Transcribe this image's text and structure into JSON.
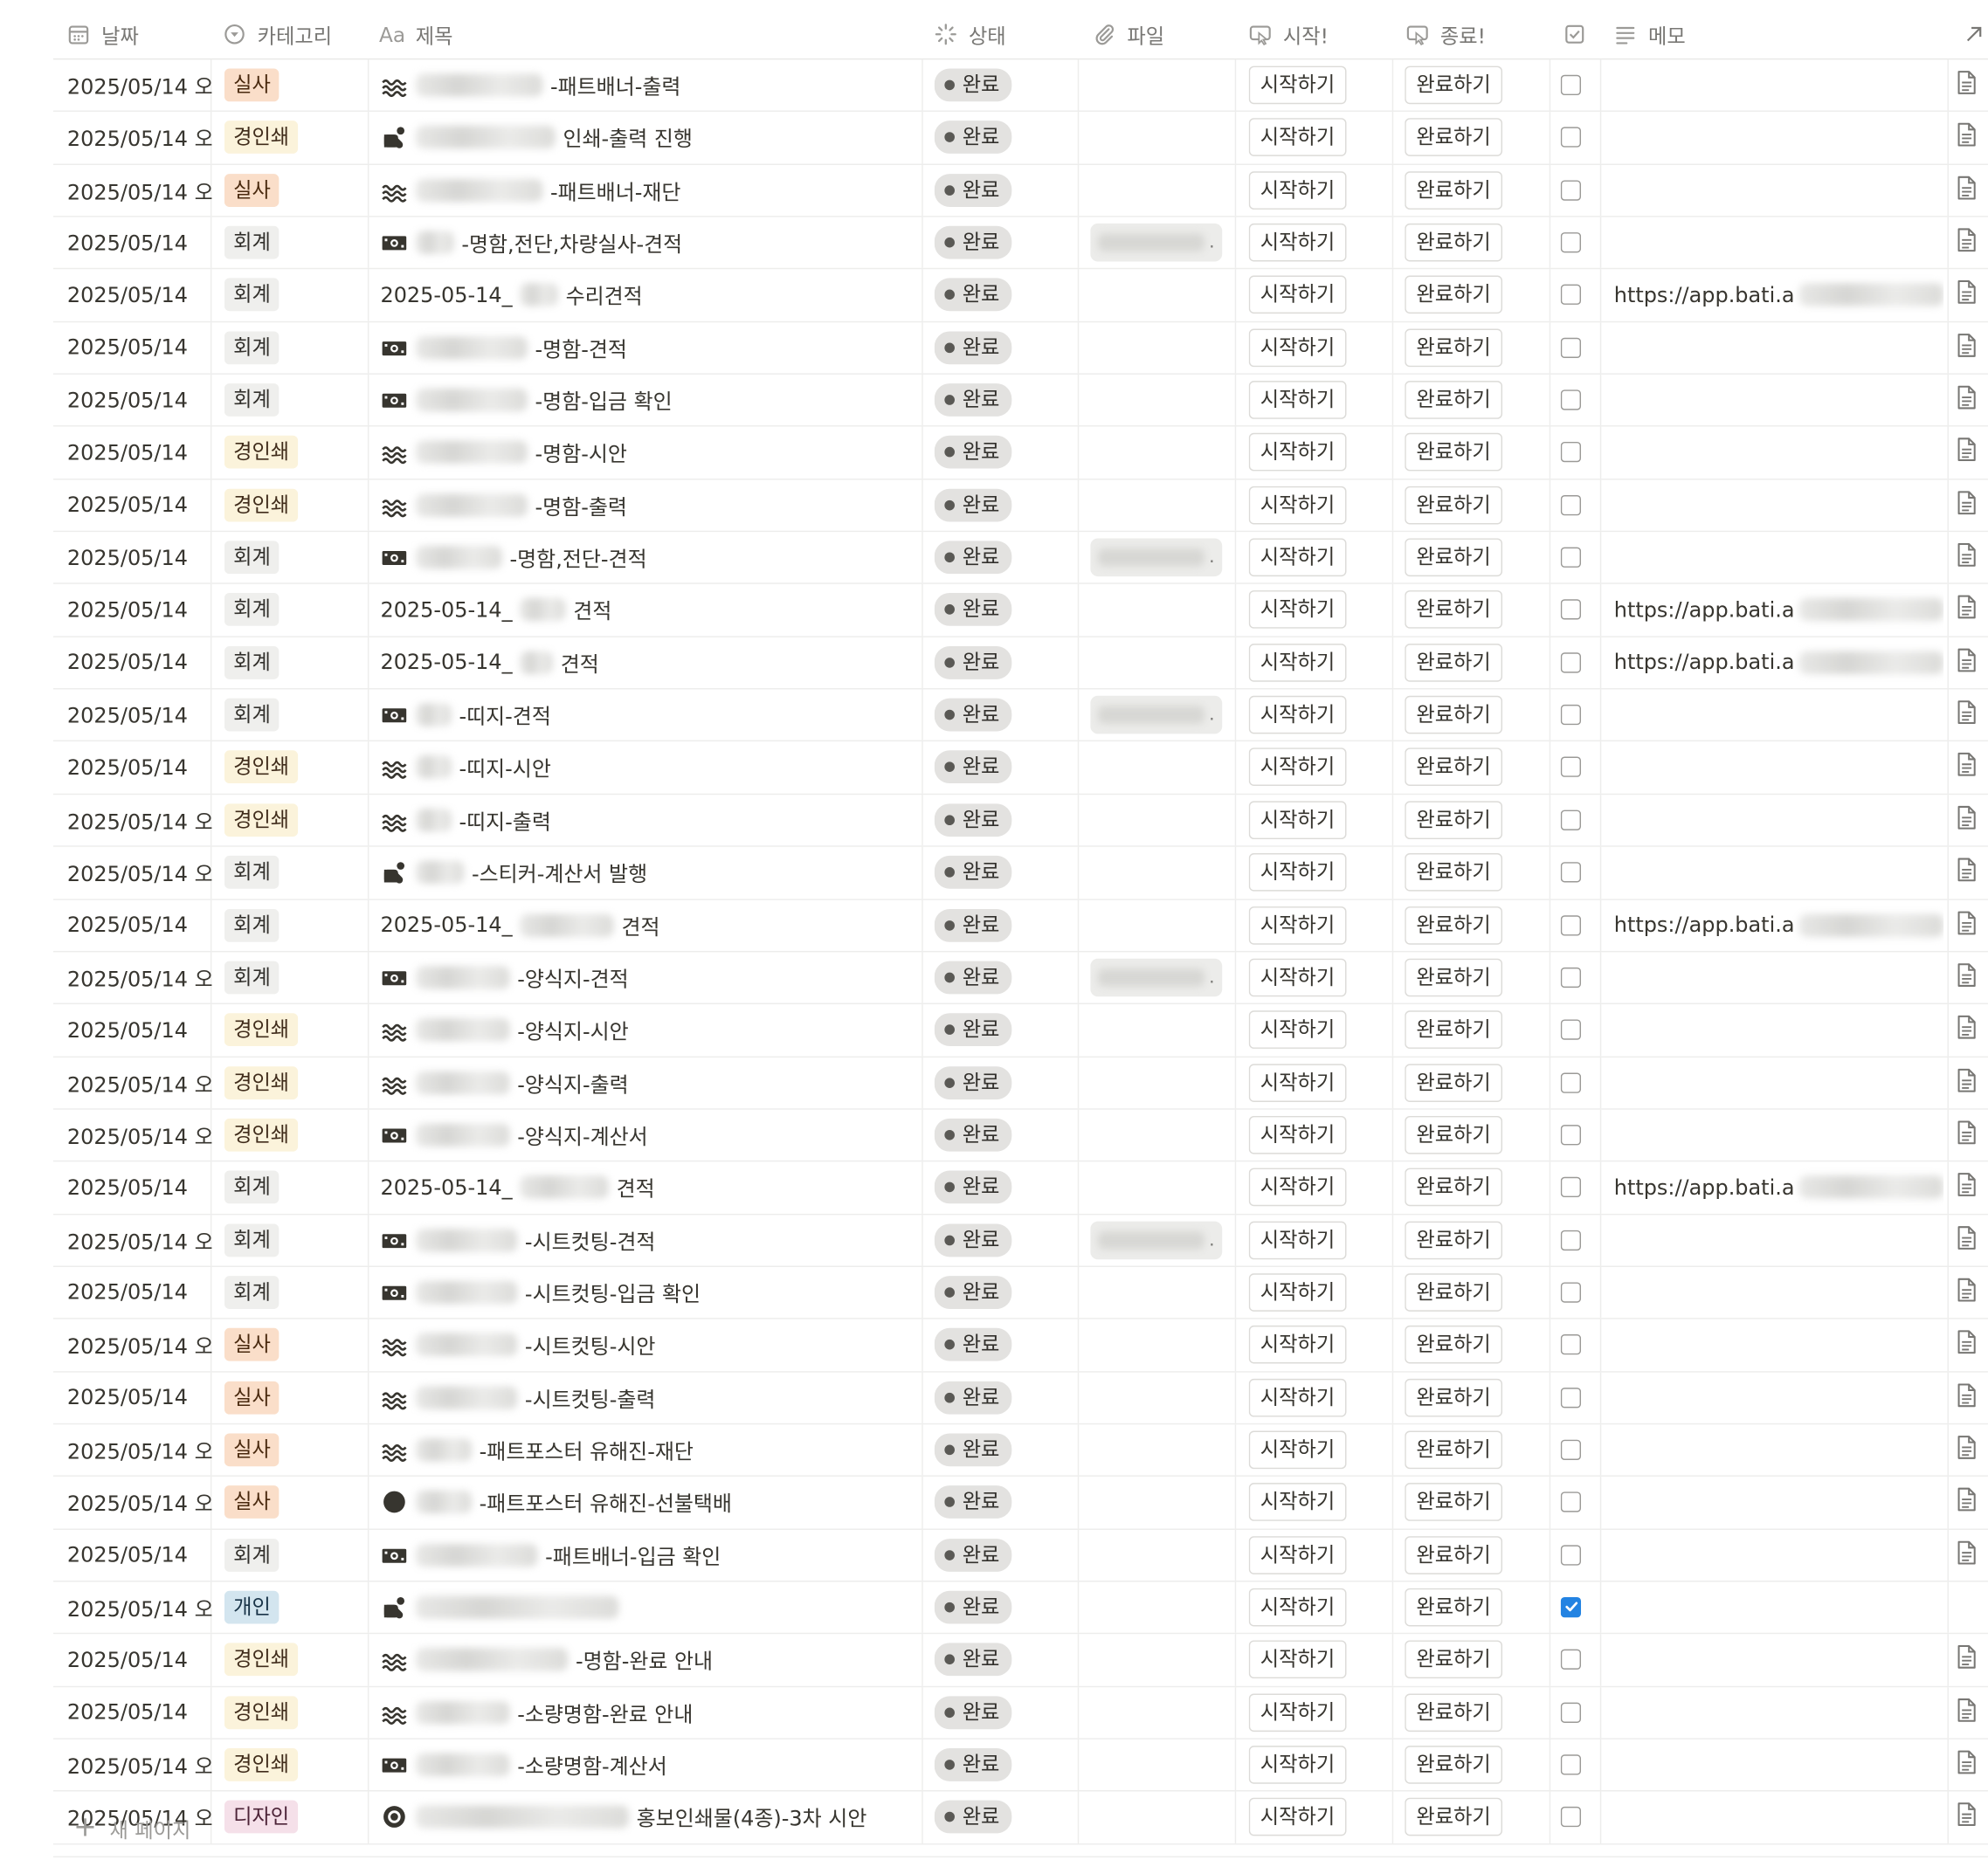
{
  "header": {
    "date": "날짜",
    "category": "카테고리",
    "title": "제목",
    "title_prefix": "Aa",
    "status": "상태",
    "file": "파일",
    "start": "시작!",
    "end": "종료!",
    "memo": "메모"
  },
  "colors": {
    "실사": {
      "bg": "#fadec9",
      "fg": "#49290e"
    },
    "경인쇄": {
      "bg": "#fbf3db",
      "fg": "#402c1b"
    },
    "회계": {
      "bg": "#efefed",
      "fg": "#32302c"
    },
    "개인": {
      "bg": "#d3e5ef",
      "fg": "#183347"
    },
    "디자인": {
      "bg": "#f5e0e9",
      "fg": "#4c2337"
    },
    "accent_blue": "#2383e2"
  },
  "new_page": "새 페이지",
  "rows": [
    {
      "date": "2025/05/14 오",
      "cat": "실사",
      "icon": "wave-icon",
      "pre": "",
      "blur": 100,
      "rest": "-패트배너-출력",
      "status": "완료",
      "file": false,
      "start": "시작하기",
      "end": "완료하기",
      "checked": false,
      "memo": "",
      "doc": true
    },
    {
      "date": "2025/05/14 오",
      "cat": "경인쇄",
      "icon": "tag-icon",
      "pre": "",
      "blur": 110,
      "rest": " 인쇄-출력 진행",
      "status": "완료",
      "file": false,
      "start": "시작하기",
      "end": "완료하기",
      "checked": false,
      "memo": "",
      "doc": true
    },
    {
      "date": "2025/05/14 오",
      "cat": "실사",
      "icon": "wave-icon",
      "pre": "",
      "blur": 100,
      "rest": "-패트배너-재단",
      "status": "완료",
      "file": false,
      "start": "시작하기",
      "end": "완료하기",
      "checked": false,
      "memo": "",
      "doc": true
    },
    {
      "date": "2025/05/14",
      "cat": "회계",
      "icon": "money-icon",
      "pre": "",
      "blur": 30,
      "rest": "-명함,전단,차량실사-견적",
      "status": "완료",
      "file": true,
      "start": "시작하기",
      "end": "완료하기",
      "checked": false,
      "memo": "",
      "doc": true
    },
    {
      "date": "2025/05/14",
      "cat": "회계",
      "icon": "",
      "pre": "2025-05-14_",
      "blur": 30,
      "rest": "수리견적",
      "status": "완료",
      "file": false,
      "start": "시작하기",
      "end": "완료하기",
      "checked": false,
      "memo": "https://app.bati.a",
      "doc": true
    },
    {
      "date": "2025/05/14",
      "cat": "회계",
      "icon": "money-icon",
      "pre": "",
      "blur": 88,
      "rest": "-명함-견적",
      "status": "완료",
      "file": false,
      "start": "시작하기",
      "end": "완료하기",
      "checked": false,
      "memo": "",
      "doc": true
    },
    {
      "date": "2025/05/14",
      "cat": "회계",
      "icon": "money-icon",
      "pre": "",
      "blur": 88,
      "rest": "-명함-입금 확인",
      "status": "완료",
      "file": false,
      "start": "시작하기",
      "end": "완료하기",
      "checked": false,
      "memo": "",
      "doc": true
    },
    {
      "date": "2025/05/14",
      "cat": "경인쇄",
      "icon": "wave-icon",
      "pre": "",
      "blur": 88,
      "rest": "-명함-시안",
      "status": "완료",
      "file": false,
      "start": "시작하기",
      "end": "완료하기",
      "checked": false,
      "memo": "",
      "doc": true
    },
    {
      "date": "2025/05/14",
      "cat": "경인쇄",
      "icon": "wave-icon",
      "pre": "",
      "blur": 88,
      "rest": "-명함-출력",
      "status": "완료",
      "file": false,
      "start": "시작하기",
      "end": "완료하기",
      "checked": false,
      "memo": "",
      "doc": true
    },
    {
      "date": "2025/05/14",
      "cat": "회계",
      "icon": "money-icon",
      "pre": "",
      "blur": 68,
      "rest": "-명함,전단-견적",
      "status": "완료",
      "file": true,
      "start": "시작하기",
      "end": "완료하기",
      "checked": false,
      "memo": "",
      "doc": true
    },
    {
      "date": "2025/05/14",
      "cat": "회계",
      "icon": "",
      "pre": "2025-05-14_",
      "blur": 36,
      "rest": "견적",
      "status": "완료",
      "file": false,
      "start": "시작하기",
      "end": "완료하기",
      "checked": false,
      "memo": "https://app.bati.a",
      "doc": true
    },
    {
      "date": "2025/05/14",
      "cat": "회계",
      "icon": "",
      "pre": "2025-05-14_",
      "blur": 26,
      "rest": "견적",
      "status": "완료",
      "file": false,
      "start": "시작하기",
      "end": "완료하기",
      "checked": false,
      "memo": "https://app.bati.a",
      "doc": true
    },
    {
      "date": "2025/05/14",
      "cat": "회계",
      "icon": "money-icon",
      "pre": "",
      "blur": 28,
      "rest": "-띠지-견적",
      "status": "완료",
      "file": true,
      "start": "시작하기",
      "end": "완료하기",
      "checked": false,
      "memo": "",
      "doc": true
    },
    {
      "date": "2025/05/14",
      "cat": "경인쇄",
      "icon": "wave-icon",
      "pre": "",
      "blur": 28,
      "rest": "-띠지-시안",
      "status": "완료",
      "file": false,
      "start": "시작하기",
      "end": "완료하기",
      "checked": false,
      "memo": "",
      "doc": true
    },
    {
      "date": "2025/05/14 오",
      "cat": "경인쇄",
      "icon": "wave-icon",
      "pre": "",
      "blur": 28,
      "rest": "-띠지-출력",
      "status": "완료",
      "file": false,
      "start": "시작하기",
      "end": "완료하기",
      "checked": false,
      "memo": "",
      "doc": true
    },
    {
      "date": "2025/05/14 오",
      "cat": "회계",
      "icon": "tag-icon",
      "pre": "",
      "blur": 38,
      "rest": "-스티커-계산서 발행",
      "status": "완료",
      "file": false,
      "start": "시작하기",
      "end": "완료하기",
      "checked": false,
      "memo": "",
      "doc": true
    },
    {
      "date": "2025/05/14",
      "cat": "회계",
      "icon": "",
      "pre": "2025-05-14_",
      "blur": 74,
      "rest": "견적",
      "status": "완료",
      "file": false,
      "start": "시작하기",
      "end": "완료하기",
      "checked": false,
      "memo": "https://app.bati.a",
      "doc": true
    },
    {
      "date": "2025/05/14 오",
      "cat": "회계",
      "icon": "money-icon",
      "pre": "",
      "blur": 74,
      "rest": "-양식지-견적",
      "status": "완료",
      "file": true,
      "start": "시작하기",
      "end": "완료하기",
      "checked": false,
      "memo": "",
      "doc": true
    },
    {
      "date": "2025/05/14",
      "cat": "경인쇄",
      "icon": "wave-icon",
      "pre": "",
      "blur": 74,
      "rest": "-양식지-시안",
      "status": "완료",
      "file": false,
      "start": "시작하기",
      "end": "완료하기",
      "checked": false,
      "memo": "",
      "doc": true
    },
    {
      "date": "2025/05/14 오",
      "cat": "경인쇄",
      "icon": "wave-icon",
      "pre": "",
      "blur": 74,
      "rest": "-양식지-출력",
      "status": "완료",
      "file": false,
      "start": "시작하기",
      "end": "완료하기",
      "checked": false,
      "memo": "",
      "doc": true
    },
    {
      "date": "2025/05/14 오",
      "cat": "경인쇄",
      "icon": "money-icon",
      "pre": "",
      "blur": 74,
      "rest": "-양식지-계산서",
      "status": "완료",
      "file": false,
      "start": "시작하기",
      "end": "완료하기",
      "checked": false,
      "memo": "",
      "doc": true
    },
    {
      "date": "2025/05/14",
      "cat": "회계",
      "icon": "",
      "pre": "2025-05-14_",
      "blur": 70,
      "rest": "견적",
      "status": "완료",
      "file": false,
      "start": "시작하기",
      "end": "완료하기",
      "checked": false,
      "memo": "https://app.bati.a",
      "doc": true
    },
    {
      "date": "2025/05/14 오",
      "cat": "회계",
      "icon": "money-icon",
      "pre": "",
      "blur": 80,
      "rest": "-시트컷팅-견적",
      "status": "완료",
      "file": true,
      "start": "시작하기",
      "end": "완료하기",
      "checked": false,
      "memo": "",
      "doc": true
    },
    {
      "date": "2025/05/14",
      "cat": "회계",
      "icon": "money-icon",
      "pre": "",
      "blur": 80,
      "rest": "-시트컷팅-입금 확인",
      "status": "완료",
      "file": false,
      "start": "시작하기",
      "end": "완료하기",
      "checked": false,
      "memo": "",
      "doc": true
    },
    {
      "date": "2025/05/14 오",
      "cat": "실사",
      "icon": "wave-icon",
      "pre": "",
      "blur": 80,
      "rest": "-시트컷팅-시안",
      "status": "완료",
      "file": false,
      "start": "시작하기",
      "end": "완료하기",
      "checked": false,
      "memo": "",
      "doc": true
    },
    {
      "date": "2025/05/14",
      "cat": "실사",
      "icon": "wave-icon",
      "pre": "",
      "blur": 80,
      "rest": "-시트컷팅-출력",
      "status": "완료",
      "file": false,
      "start": "시작하기",
      "end": "완료하기",
      "checked": false,
      "memo": "",
      "doc": true
    },
    {
      "date": "2025/05/14 오",
      "cat": "실사",
      "icon": "wave-icon",
      "pre": "",
      "blur": 44,
      "rest": "-패트포스터 유해진-재단",
      "status": "완료",
      "file": false,
      "start": "시작하기",
      "end": "완료하기",
      "checked": false,
      "memo": "",
      "doc": true
    },
    {
      "date": "2025/05/14 오",
      "cat": "실사",
      "icon": "circle-icon",
      "pre": "",
      "blur": 44,
      "rest": "-패트포스터 유해진-선불택배",
      "status": "완료",
      "file": false,
      "start": "시작하기",
      "end": "완료하기",
      "checked": false,
      "memo": "",
      "doc": true
    },
    {
      "date": "2025/05/14",
      "cat": "회계",
      "icon": "money-icon",
      "pre": "",
      "blur": 96,
      "rest": "-패트배너-입금 확인",
      "status": "완료",
      "file": false,
      "start": "시작하기",
      "end": "완료하기",
      "checked": false,
      "memo": "",
      "doc": true
    },
    {
      "date": "2025/05/14 오",
      "cat": "개인",
      "icon": "tag-icon",
      "pre": "",
      "blur": 160,
      "rest": "",
      "status": "완료",
      "file": false,
      "start": "시작하기",
      "end": "완료하기",
      "checked": true,
      "memo": "",
      "doc": false
    },
    {
      "date": "2025/05/14",
      "cat": "경인쇄",
      "icon": "wave-icon",
      "pre": "",
      "blur": 120,
      "rest": "-명함-완료 안내",
      "status": "완료",
      "file": false,
      "start": "시작하기",
      "end": "완료하기",
      "checked": false,
      "memo": "",
      "doc": true
    },
    {
      "date": "2025/05/14",
      "cat": "경인쇄",
      "icon": "wave-icon",
      "pre": "",
      "blur": 74,
      "rest": "-소량명함-완료 안내",
      "status": "완료",
      "file": false,
      "start": "시작하기",
      "end": "완료하기",
      "checked": false,
      "memo": "",
      "doc": true
    },
    {
      "date": "2025/05/14 오",
      "cat": "경인쇄",
      "icon": "money-icon",
      "pre": "",
      "blur": 74,
      "rest": "-소량명함-계산서",
      "status": "완료",
      "file": false,
      "start": "시작하기",
      "end": "완료하기",
      "checked": false,
      "memo": "",
      "doc": true
    },
    {
      "date": "2025/05/14 오",
      "cat": "디자인",
      "icon": "target-icon",
      "pre": "",
      "blur": 168,
      "rest": "홍보인쇄물(4종)-3차 시안",
      "status": "완료",
      "file": false,
      "start": "시작하기",
      "end": "완료하기",
      "checked": false,
      "memo": "",
      "doc": true
    }
  ]
}
